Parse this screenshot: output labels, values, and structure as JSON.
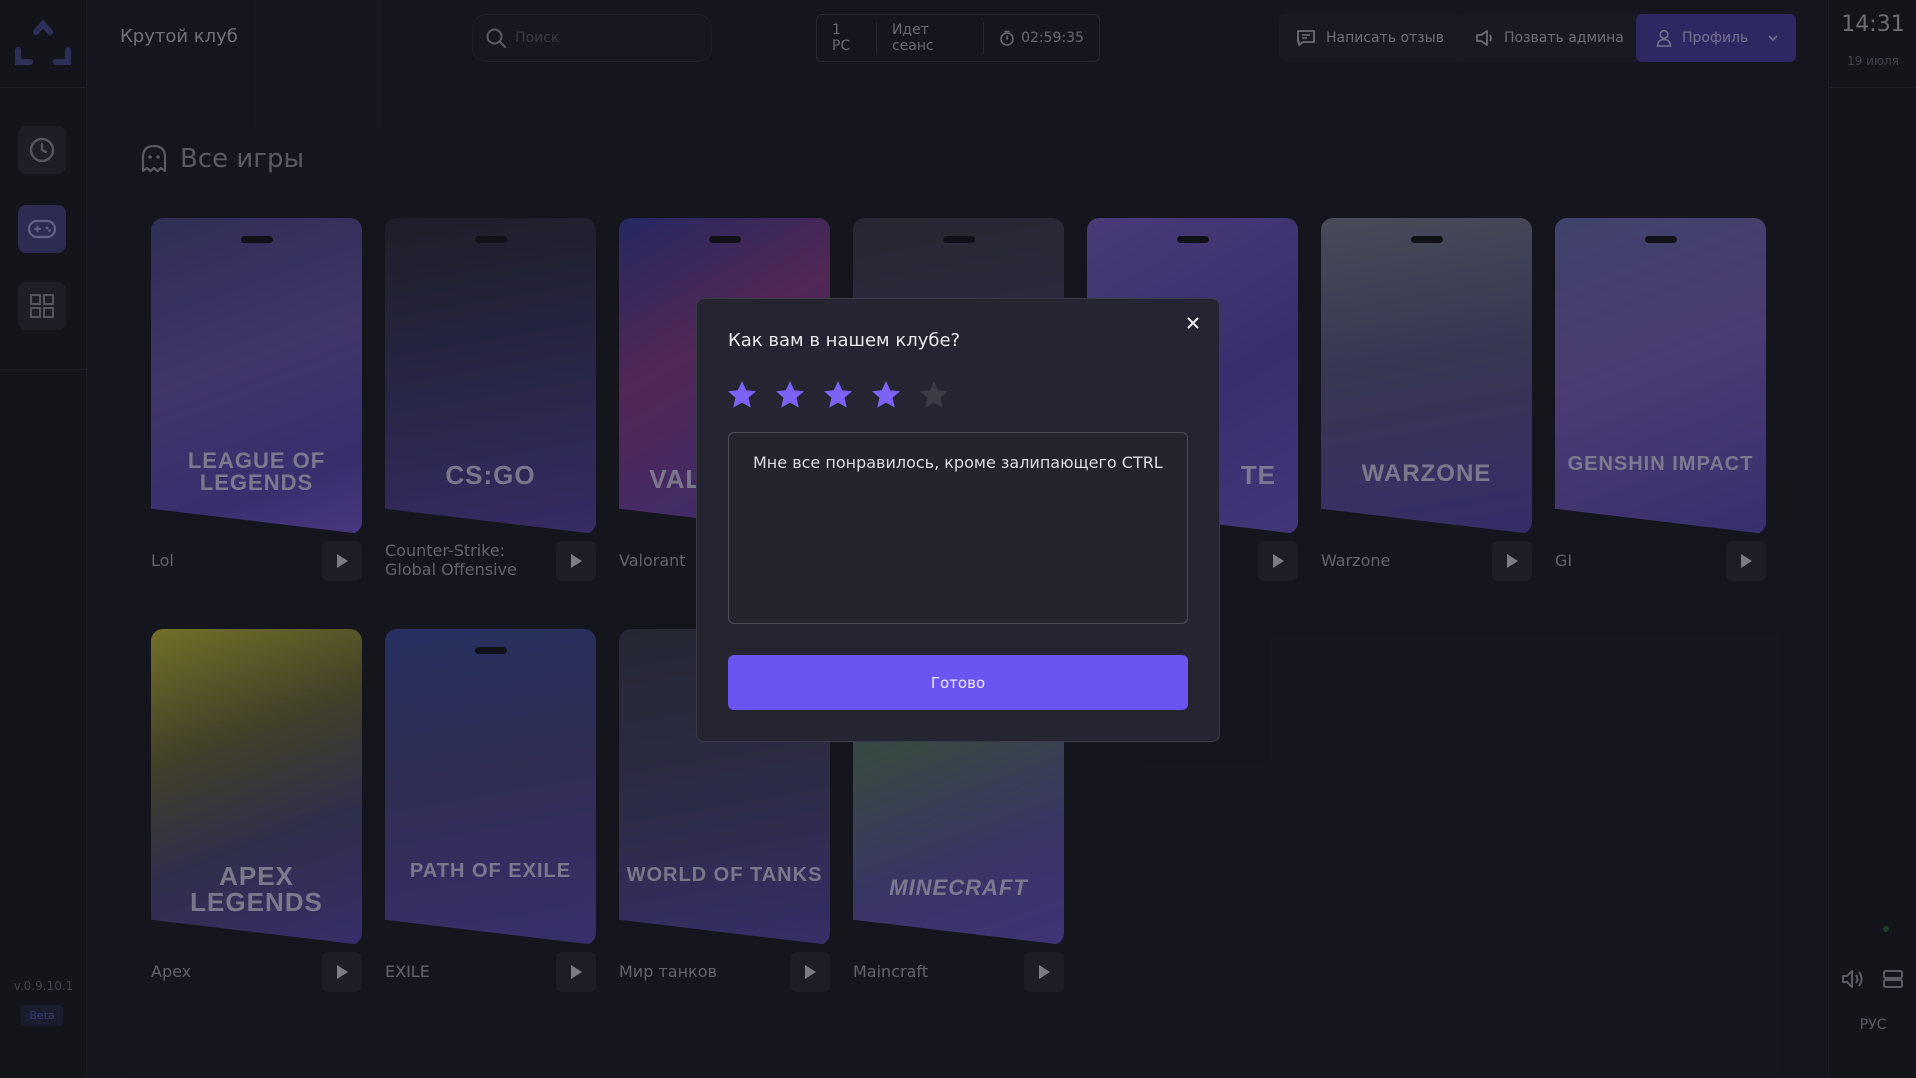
{
  "app": {
    "club_name": "Крутой клуб",
    "version": "v.0.9.10.1",
    "beta": "Beta"
  },
  "search": {
    "placeholder": "Поиск"
  },
  "session": {
    "pc": "1 PC",
    "status": "Идет сеанс",
    "timer": "02:59:35"
  },
  "header": {
    "feedback_label": "Написать отзыв",
    "call_admin_label": "Позвать админа",
    "profile_label": "Профиль"
  },
  "clock": {
    "time": "14:31",
    "date": "19 июля"
  },
  "language": "РУС",
  "section": {
    "title": "Все игры"
  },
  "games": [
    {
      "name": "Lol",
      "logo": "LEAGUE OF LEGENDS"
    },
    {
      "name": "Counter-Strike: Global Offensive",
      "logo": "CS:GO"
    },
    {
      "name": "Valorant",
      "logo": "VALORANT"
    },
    {
      "name": "",
      "logo": ""
    },
    {
      "name": "",
      "logo": "TE"
    },
    {
      "name": "Warzone",
      "logo": "WARZONE"
    },
    {
      "name": "GI",
      "logo": "GENSHIN IMPACT"
    },
    {
      "name": "Apex",
      "logo": "APEX LEGENDS"
    },
    {
      "name": "EXILE",
      "logo": "PATH OF EXILE"
    },
    {
      "name": "Мир танков",
      "logo": "WORLD OF TANKS"
    },
    {
      "name": "Maincraft",
      "logo": "MINECRAFT"
    }
  ],
  "modal": {
    "title": "Как вам в нашем клубе?",
    "rating": 4,
    "rating_max": 5,
    "review_text": "Мне все понравилось, кроме залипающего CTRL",
    "submit_label": "Готово"
  },
  "colors": {
    "background": "#1d1e26",
    "accent": "#6a54f2",
    "profile_button": "#4a3fa3",
    "star_active": "#7c63f5",
    "star_inactive": "#3a3b44"
  }
}
